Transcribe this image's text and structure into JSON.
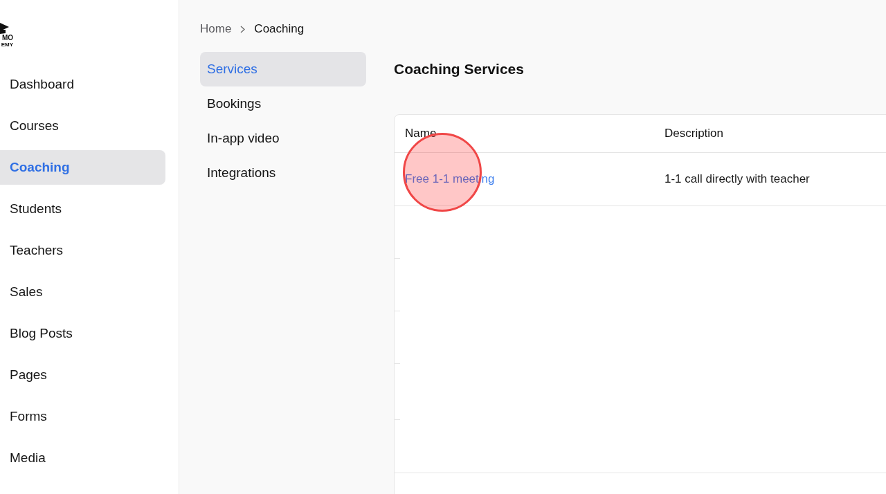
{
  "logo": {
    "lines": [
      "MO",
      "EMY"
    ]
  },
  "sidebar": {
    "items": [
      {
        "label": "Dashboard",
        "selected": false
      },
      {
        "label": "Courses",
        "selected": false
      },
      {
        "label": "Coaching",
        "selected": true
      },
      {
        "label": "Students",
        "selected": false
      },
      {
        "label": "Teachers",
        "selected": false
      },
      {
        "label": "Sales",
        "selected": false
      },
      {
        "label": "Blog Posts",
        "selected": false
      },
      {
        "label": "Pages",
        "selected": false
      },
      {
        "label": "Forms",
        "selected": false
      },
      {
        "label": "Media",
        "selected": false
      }
    ]
  },
  "breadcrumb": [
    {
      "label": "Home",
      "current": false
    },
    {
      "label": "Coaching",
      "current": true
    }
  ],
  "subnav": {
    "items": [
      {
        "label": "Services",
        "selected": true
      },
      {
        "label": "Bookings",
        "selected": false
      },
      {
        "label": "In-app video",
        "selected": false
      },
      {
        "label": "Integrations",
        "selected": false
      }
    ]
  },
  "page_title": "Coaching Services",
  "table": {
    "columns": [
      "Name",
      "Description"
    ],
    "rows": [
      {
        "cells": [
          "Free 1-1 meeting",
          "1-1 call directly with teacher"
        ],
        "click_marker": true
      }
    ]
  }
}
